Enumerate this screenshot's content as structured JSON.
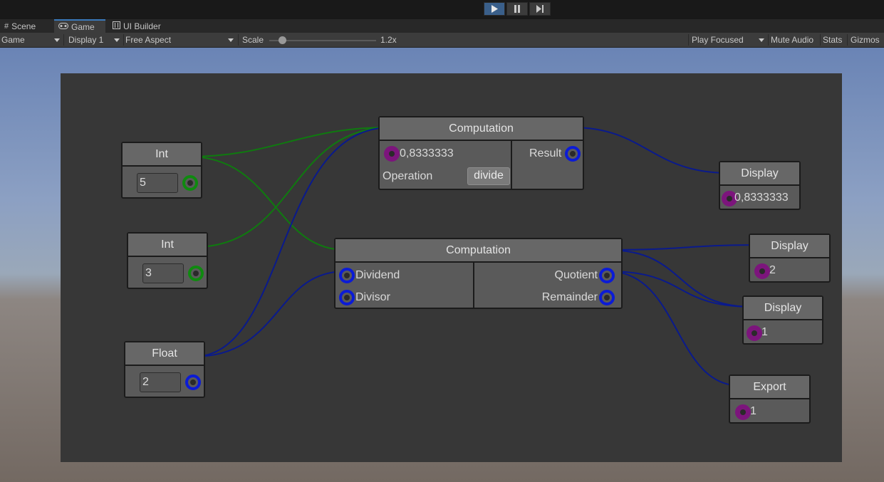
{
  "playbar": {
    "play_icon": "play-icon",
    "pause_icon": "pause-icon",
    "step_icon": "step-icon",
    "accent": "#3a5f8a"
  },
  "tabs": [
    {
      "label": "Scene",
      "icon": "hash-icon"
    },
    {
      "label": "Game",
      "icon": "gamepad-icon"
    },
    {
      "label": "UI Builder",
      "icon": "ui-builder-icon"
    }
  ],
  "toolbar": {
    "view_select": "Game",
    "display_select": "Display 1",
    "aspect_select": "Free Aspect",
    "scale_label": "Scale",
    "scale_value": "1.2x",
    "play_mode_select": "Play Focused",
    "mute_audio": "Mute Audio",
    "stats": "Stats",
    "gizmos": "Gizmos"
  },
  "nodes": {
    "int1": {
      "title": "Int",
      "value": "5"
    },
    "int2": {
      "title": "Int",
      "value": "3"
    },
    "float1": {
      "title": "Float",
      "value": "2"
    },
    "comp1": {
      "title": "Computation",
      "input_value": "0,8333333",
      "operation_label": "Operation",
      "operation_value": "divide",
      "output_label": "Result"
    },
    "comp2": {
      "title": "Computation",
      "dividend_label": "Dividend",
      "divisor_label": "Divisor",
      "quotient_label": "Quotient",
      "remainder_label": "Remainder"
    },
    "display1": {
      "title": "Display",
      "value": "0,8333333"
    },
    "display2": {
      "title": "Display",
      "value": "2"
    },
    "display3": {
      "title": "Display",
      "value": "1"
    },
    "export1": {
      "title": "Export",
      "value": "1"
    }
  },
  "colors": {
    "int_wire": "#0f7a0f",
    "float_wire": "#0a1a8c",
    "input_port": "#7c157c"
  }
}
